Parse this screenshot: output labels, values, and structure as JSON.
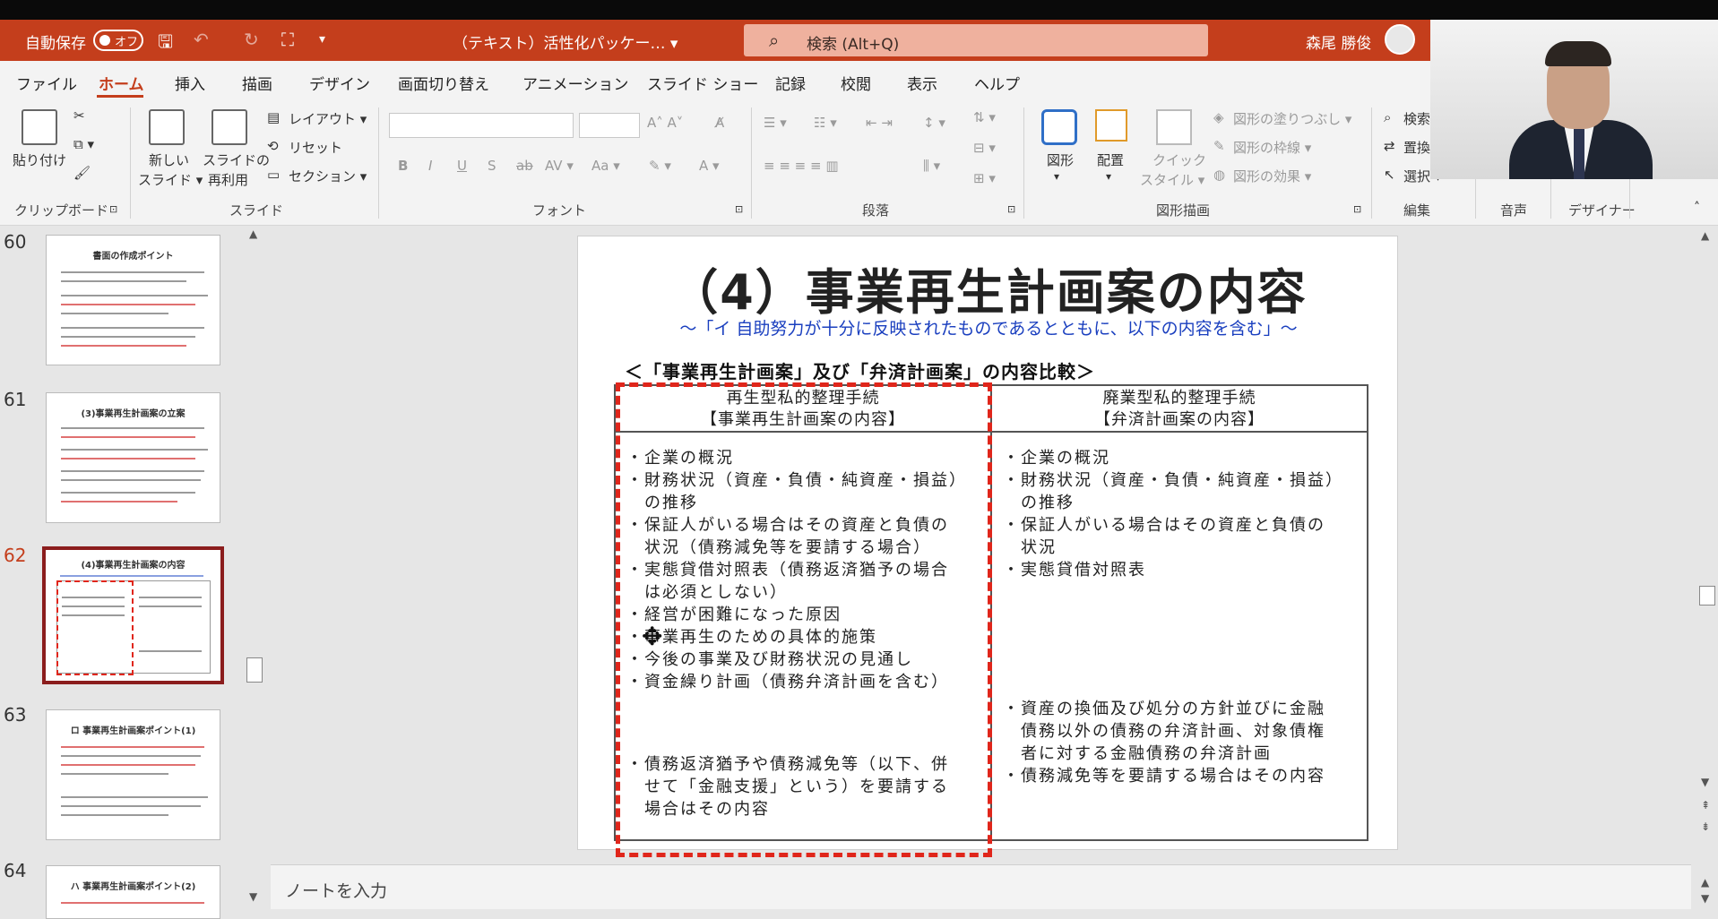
{
  "titlebar": {
    "autosave_label": "自動保存",
    "autosave_state": "オフ",
    "document_title": "（テキスト）活性化パッケー… ▾",
    "search_placeholder": "検索 (Alt+Q)",
    "user_name": "森尾 勝俊"
  },
  "menu": {
    "tabs": [
      "ファイル",
      "ホーム",
      "挿入",
      "描画",
      "デザイン",
      "画面切り替え",
      "アニメーション",
      "スライド ショー",
      "記録",
      "校閲",
      "表示",
      "ヘルプ"
    ],
    "active_tab": "ホーム"
  },
  "ribbon": {
    "clipboard": {
      "paste": "貼り付け",
      "group": "クリップボード"
    },
    "slides": {
      "new_slide": "新しい",
      "new_slide2": "スライド ▾",
      "reuse": "スライドの",
      "reuse2": "再利用",
      "layout": "レイアウト ▾",
      "reset": "リセット",
      "section": "セクション ▾",
      "group": "スライド"
    },
    "font": {
      "group": "フォント",
      "bold": "B",
      "italic": "I",
      "underline": "U",
      "shadow": "S",
      "strike": "ab",
      "spacing": "AV ▾",
      "case": "Aa ▾"
    },
    "paragraph": {
      "group": "段落"
    },
    "drawing": {
      "shape": "図形",
      "arrange": "配置",
      "quick": "クイック",
      "quick2": "スタイル ▾",
      "fill": "図形の塗りつぶし ▾",
      "outline": "図形の枠線 ▾",
      "effect": "図形の効果 ▾",
      "group": "図形描画"
    },
    "editing": {
      "find": "検索",
      "replace": "置換",
      "select": "選択 ▾",
      "group": "編集"
    },
    "voice": {
      "group": "音声"
    },
    "designer": {
      "group": "デザイナー"
    }
  },
  "slides_panel": {
    "numbers": [
      "60",
      "61",
      "62",
      "63",
      "64"
    ],
    "titles": [
      "書面の作成ポイント",
      "(3)事業再生計画案の立案",
      "(4)事業再生計画案の内容",
      "ロ 事業再生計画案ポイント(1)",
      "ハ 事業再生計画案ポイント(2)"
    ],
    "active_index": 2
  },
  "slide": {
    "title": "（4）事業再生計画案の内容",
    "subtitle": "～「イ 自助努力が十分に反映されたものであるとともに、以下の内容を含む」～",
    "comparison_heading": "＜「事業再生計画案」及び「弁済計画案」の内容比較＞",
    "left_header": [
      "再生型私的整理手続",
      "【事業再生計画案の内容】"
    ],
    "right_header": [
      "廃業型私的整理手続",
      "【弁済計画案の内容】"
    ],
    "left_items": [
      "・企業の概況",
      "・財務状況（資産・負債・純資産・損益）",
      "　の推移",
      "・保証人がいる場合はその資産と負債の",
      "　状況（債務減免等を要請する場合）",
      "・実態貸借対照表（債務返済猶予の場合",
      "　は必須としない）",
      "・経営が困難になった原因",
      "・事業再生のための具体的施策",
      "・今後の事業及び財務状況の見通し",
      "・資金繰り計画（債務弁済計画を含む）"
    ],
    "left_items_bottom": [
      "・債務返済猶予や債務減免等（以下、併",
      "　せて「金融支援」という）を要請する",
      "　場合はその内容"
    ],
    "right_items": [
      "・企業の概況",
      "・財務状況（資産・負債・純資産・損益）",
      "　の推移",
      "・保証人がいる場合はその資産と負債の",
      "　状況",
      "・実態貸借対照表"
    ],
    "right_items_bottom": [
      "・資産の換価及び処分の方針並びに金融",
      "　債務以外の債務の弁済計画、対象債権",
      "　者に対する金融債務の弁済計画",
      "・債務減免等を要請する場合はその内容"
    ]
  },
  "notes": {
    "placeholder": "ノートを入力"
  },
  "colors": {
    "accent": "#c43e1c",
    "highlight_box": "#e0261b",
    "subtitle": "#1a3fbf"
  }
}
